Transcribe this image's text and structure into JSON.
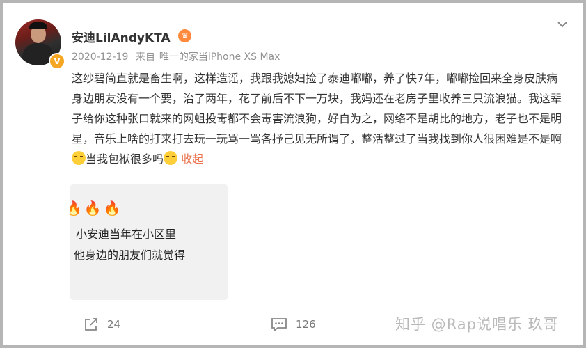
{
  "user": {
    "name": "安迪LilAndyKTA",
    "verified_badge": "V",
    "badge_icon": "fan-badge-icon"
  },
  "meta": {
    "date": "2020-12-19",
    "from_label": "来自",
    "source": "唯一的家当iPhone XS Max"
  },
  "post": {
    "text": "这纱碧简直就是畜生啊，这样造谣，我跟我媳妇捡了泰迪嘟嘟，养了快7年，嘟嘟捡回来全身皮肤病身边朋友没有一个要，治了两年，花了前后不下一万块，我妈还在老房子里收养三只流浪猫。我这辈子给你这种张口就来的网蛆投毒都不会毒害流浪狗，好自为之，网络不是胡比的地方，老子也不是明星，音乐上啥的打来打去玩一玩骂一骂各抒己见无所谓了，整活整过了当我找到你人很困难是不是啊",
    "text_tail": "当我包袱很多吗",
    "collapse_label": "收起"
  },
  "thumbnail": {
    "flames": "🔥🔥🔥",
    "line1": "，小安迪当年在小区里",
    "line2": "他身边的朋友们就觉得"
  },
  "actions": {
    "repost_count": "24",
    "comment_count": "126"
  },
  "watermark": "知乎 @Rap说唱乐 玖哥",
  "colors": {
    "accent": "#eb7350",
    "verified": "#f5a623",
    "meta": "#939393"
  }
}
